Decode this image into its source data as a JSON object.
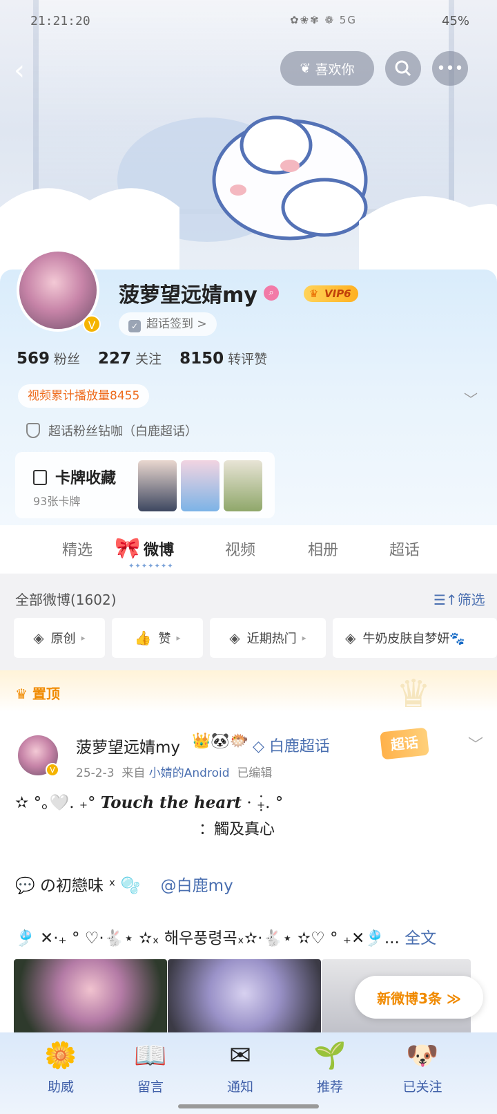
{
  "status_bar": {
    "time": "21:21:20",
    "icons": "✿❀✾ ❁ 5G",
    "battery": "45%"
  },
  "header": {
    "like_button": "喜欢你",
    "back_icon": "back-arrow-icon",
    "search_icon": "search-icon",
    "more_icon": "more-icon"
  },
  "profile": {
    "name": "菠萝望远婧my",
    "vip_level": "VIP6",
    "signin": "超话签到 >",
    "followers_count": "569",
    "followers_label": "粉丝",
    "following_count": "227",
    "following_label": "关注",
    "likes_count": "8150",
    "likes_label": "转评赞",
    "play_count": "视频累计播放量8455",
    "fan_badge": "超话粉丝钻咖（白鹿超话）",
    "card_title": "卡牌收藏",
    "card_count": "93张卡牌"
  },
  "tabs": [
    "精选",
    "微博",
    "视频",
    "相册",
    "超话"
  ],
  "filter": {
    "all_weibo": "全部微博(1602)",
    "sort": "筛选",
    "chips": [
      "原创",
      "赞",
      "近期热门",
      "牛奶皮肤自梦妍🐾"
    ]
  },
  "pinned": {
    "label": "置顶"
  },
  "post": {
    "author": "菠萝望远婧my",
    "emojis": "👑🐼🐡",
    "super_topic": "◇ 白鹿超话",
    "super_tag": "超话",
    "date": "25-2-3",
    "from_label": "来自",
    "device": "小婧的Android",
    "edited": "已编辑",
    "line1_prefix": "✫ °｡🤍. ₊°",
    "line1_text": "Touch the heart",
    "line1_suffix": "· ₊̣̇. °",
    "line2": "：觸及真心",
    "line3_prefix": "💬 の初戀味 ˣ 🫧",
    "line3_mention": "@白鹿my",
    "line4": "🎐 ✕·₊ ° ♡·🐇⋆ ✫ₓ 해우풍령곡ₓ✫·🐇⋆ ✫♡ ° ₊✕🎐...",
    "full_text": "全文",
    "new_posts": "新微博3条 ≫"
  },
  "bottom_nav": [
    {
      "label": "助威",
      "icon": "flower-icon"
    },
    {
      "label": "留言",
      "icon": "book-icon"
    },
    {
      "label": "通知",
      "icon": "envelope-icon"
    },
    {
      "label": "推荐",
      "icon": "plant-icon"
    },
    {
      "label": "已关注",
      "icon": "puppy-icon"
    }
  ]
}
